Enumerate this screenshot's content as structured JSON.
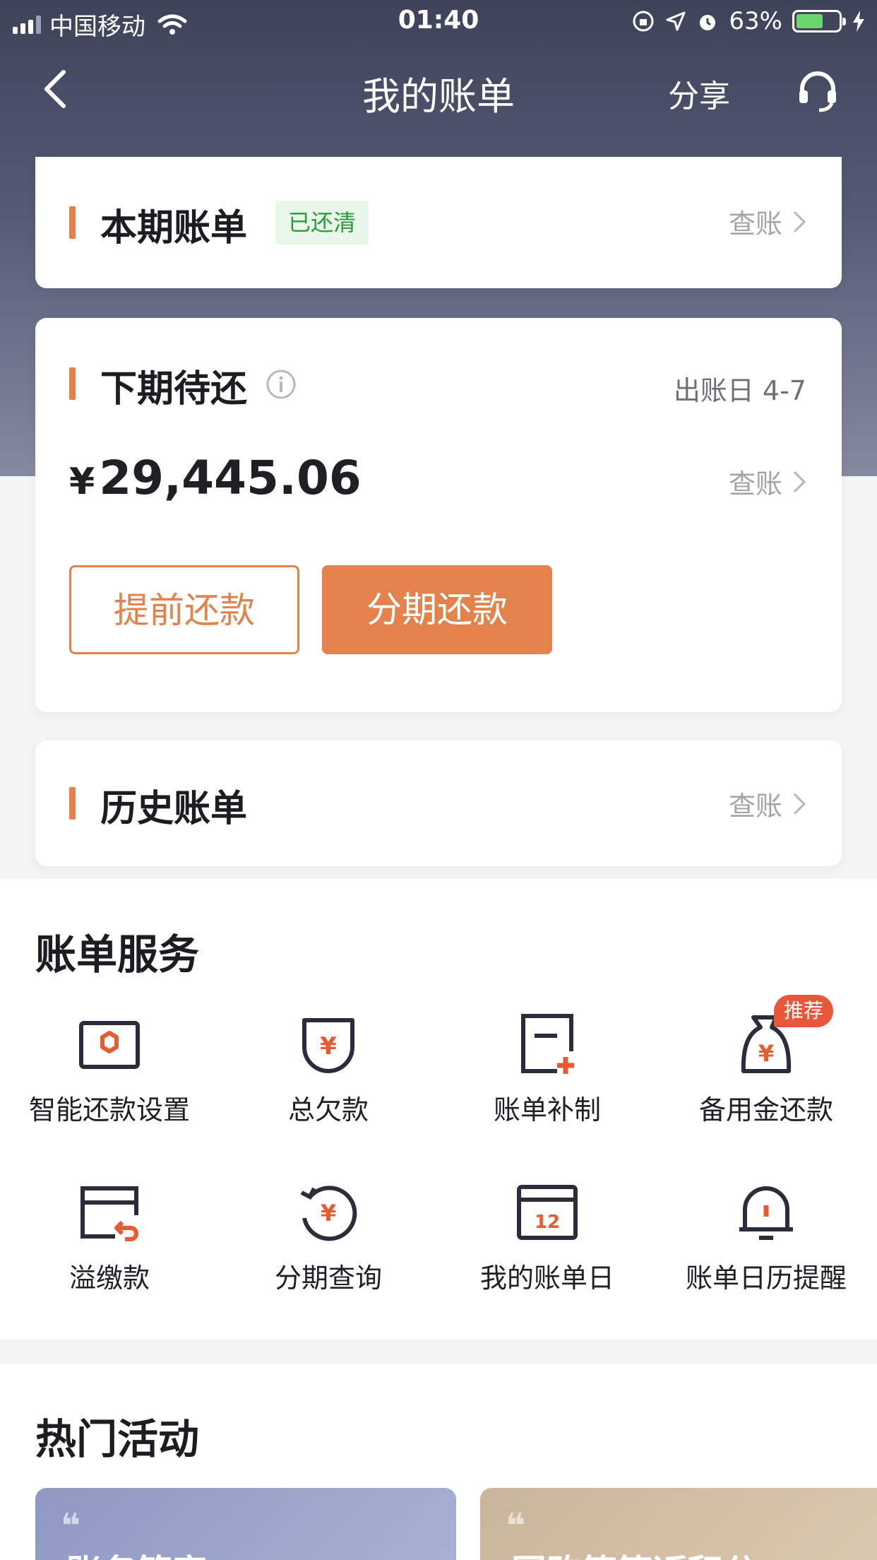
{
  "status_bar": {
    "carrier": "中国移动",
    "time": "01:40",
    "battery": "63%"
  },
  "nav": {
    "title": "我的账单",
    "share": "分享"
  },
  "current_bill": {
    "title": "本期账单",
    "badge": "已还清",
    "link": "查账"
  },
  "next_bill": {
    "title": "下期待还",
    "bill_date": "出账日 4-7",
    "currency": "¥",
    "amount": "29,445.06",
    "link": "查账",
    "prepay_label": "提前还款",
    "installment_label": "分期还款"
  },
  "history_bill": {
    "title": "历史账单",
    "link": "查账"
  },
  "services": {
    "title": "账单服务",
    "recommend_badge": "推荐",
    "items": [
      {
        "label": "智能还款设置",
        "icon": "smart-repay-icon"
      },
      {
        "label": "总欠款",
        "icon": "total-debt-icon"
      },
      {
        "label": "账单补制",
        "icon": "bill-reissue-icon"
      },
      {
        "label": "备用金还款",
        "icon": "reserve-fund-icon"
      },
      {
        "label": "溢缴款",
        "icon": "overpayment-icon"
      },
      {
        "label": "分期查询",
        "icon": "installment-query-icon"
      },
      {
        "label": "我的账单日",
        "icon": "calendar-icon"
      },
      {
        "label": "账单日历提醒",
        "icon": "bell-icon"
      }
    ]
  },
  "activities": {
    "title": "热门活动",
    "cards": [
      {
        "text": "账务管家"
      },
      {
        "text": "国购等等返积分"
      }
    ]
  },
  "colors": {
    "accent": "#e5814a",
    "header": "#3e4359",
    "paid_green": "#2f9a3d",
    "recommend_red": "#e8573a"
  }
}
